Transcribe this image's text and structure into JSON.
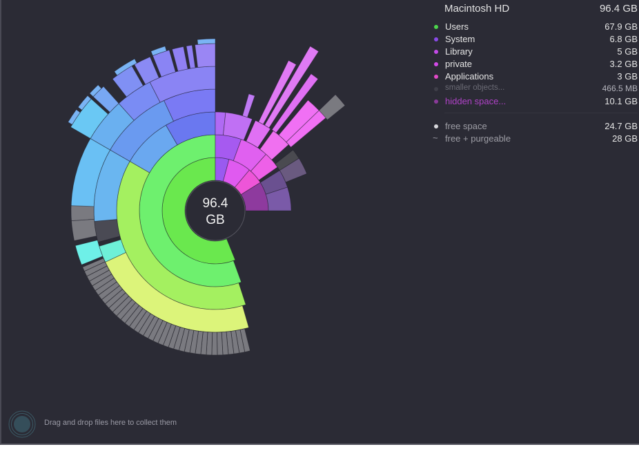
{
  "app": {
    "center_label": {
      "value": "96.4",
      "unit": "GB"
    },
    "dropzone_text": "Drag and drop files here to collect them"
  },
  "legend": {
    "disk_name": "Macintosh HD",
    "disk_size": "96.4 GB",
    "items": [
      {
        "label": "Users",
        "size": "67.9 GB",
        "color": "#4cd64c"
      },
      {
        "label": "System",
        "size": "6.8 GB",
        "color": "#8a4ae8"
      },
      {
        "label": "Library",
        "size": "5   GB",
        "color": "#c34ae8"
      },
      {
        "label": "private",
        "size": "3.2 GB",
        "color": "#d24ae8"
      },
      {
        "label": "Applications",
        "size": "3   GB",
        "color": "#e24ac8"
      },
      {
        "label": "smaller objects...",
        "size": "466.5 MB",
        "color": "#3e3e48",
        "style": "dim"
      },
      {
        "label": "hidden space...",
        "size": "10.1 GB",
        "color": "#8a3a9a",
        "style": "hidden"
      }
    ],
    "free_items": [
      {
        "label": "free space",
        "size": "24.7 GB",
        "color": "#d8d8dc",
        "marker": "dot"
      },
      {
        "label": "free + purgeable",
        "size": "28   GB",
        "color": "#9a9aa3",
        "marker": "tilde"
      }
    ]
  },
  "chart_data": {
    "type": "sunburst",
    "title": "Macintosh HD",
    "total": "96.4 GB",
    "rings": [
      {
        "level": 1,
        "segments": [
          {
            "name": "Users",
            "value": 67.9,
            "color": "#6ce84c"
          },
          {
            "name": "System",
            "value": 6.8,
            "color": "#9a5af0"
          },
          {
            "name": "Library",
            "value": 5.0,
            "color": "#d35af0"
          },
          {
            "name": "private",
            "value": 3.2,
            "color": "#ee55d8"
          },
          {
            "name": "Applications",
            "value": 3.0,
            "color": "#8e3a9e"
          },
          {
            "name": "smaller objects",
            "value": 0.47,
            "color": "#3a3a44"
          },
          {
            "name": "hidden space",
            "value": 10.1,
            "color": "#2b2b35"
          }
        ]
      }
    ]
  }
}
